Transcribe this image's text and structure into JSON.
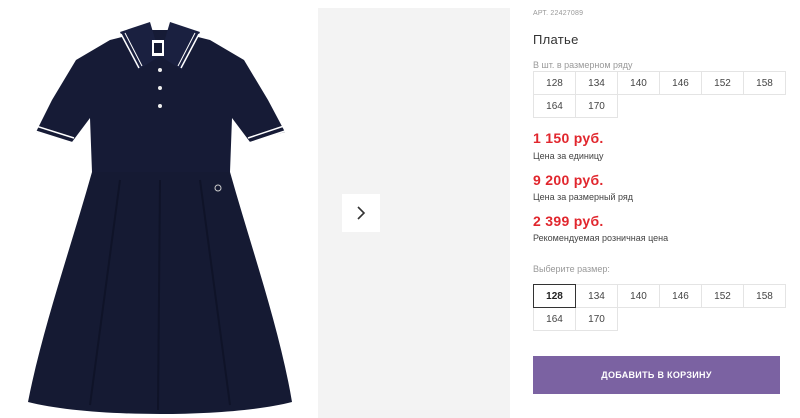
{
  "product": {
    "article": "АРТ. 22427089",
    "title": "Платье"
  },
  "size_ranges": {
    "label": "В шт. в размерном ряду",
    "sizes": [
      "128",
      "134",
      "140",
      "146",
      "152",
      "158",
      "164",
      "170"
    ]
  },
  "prices": [
    {
      "amount": "1 150 руб.",
      "note": "Цена за единицу"
    },
    {
      "amount": "9 200 руб.",
      "note": "Цена за размерный ряд"
    },
    {
      "amount": "2 399 руб.",
      "note": "Рекомендуемая розничная цена"
    }
  ],
  "size_select": {
    "label": "Выберите размер:",
    "sizes": [
      "128",
      "134",
      "140",
      "146",
      "152",
      "158",
      "164",
      "170"
    ],
    "selected": "128"
  },
  "cart": {
    "button_label": "ДОБАВИТЬ В КОРЗИНУ"
  },
  "gallery": {
    "next_icon": "chevron-right-icon"
  },
  "colors": {
    "price": "#e1262d",
    "button": "#7b62a2",
    "dress": "#151a33",
    "thumb_bg": "#f3f3f3"
  }
}
